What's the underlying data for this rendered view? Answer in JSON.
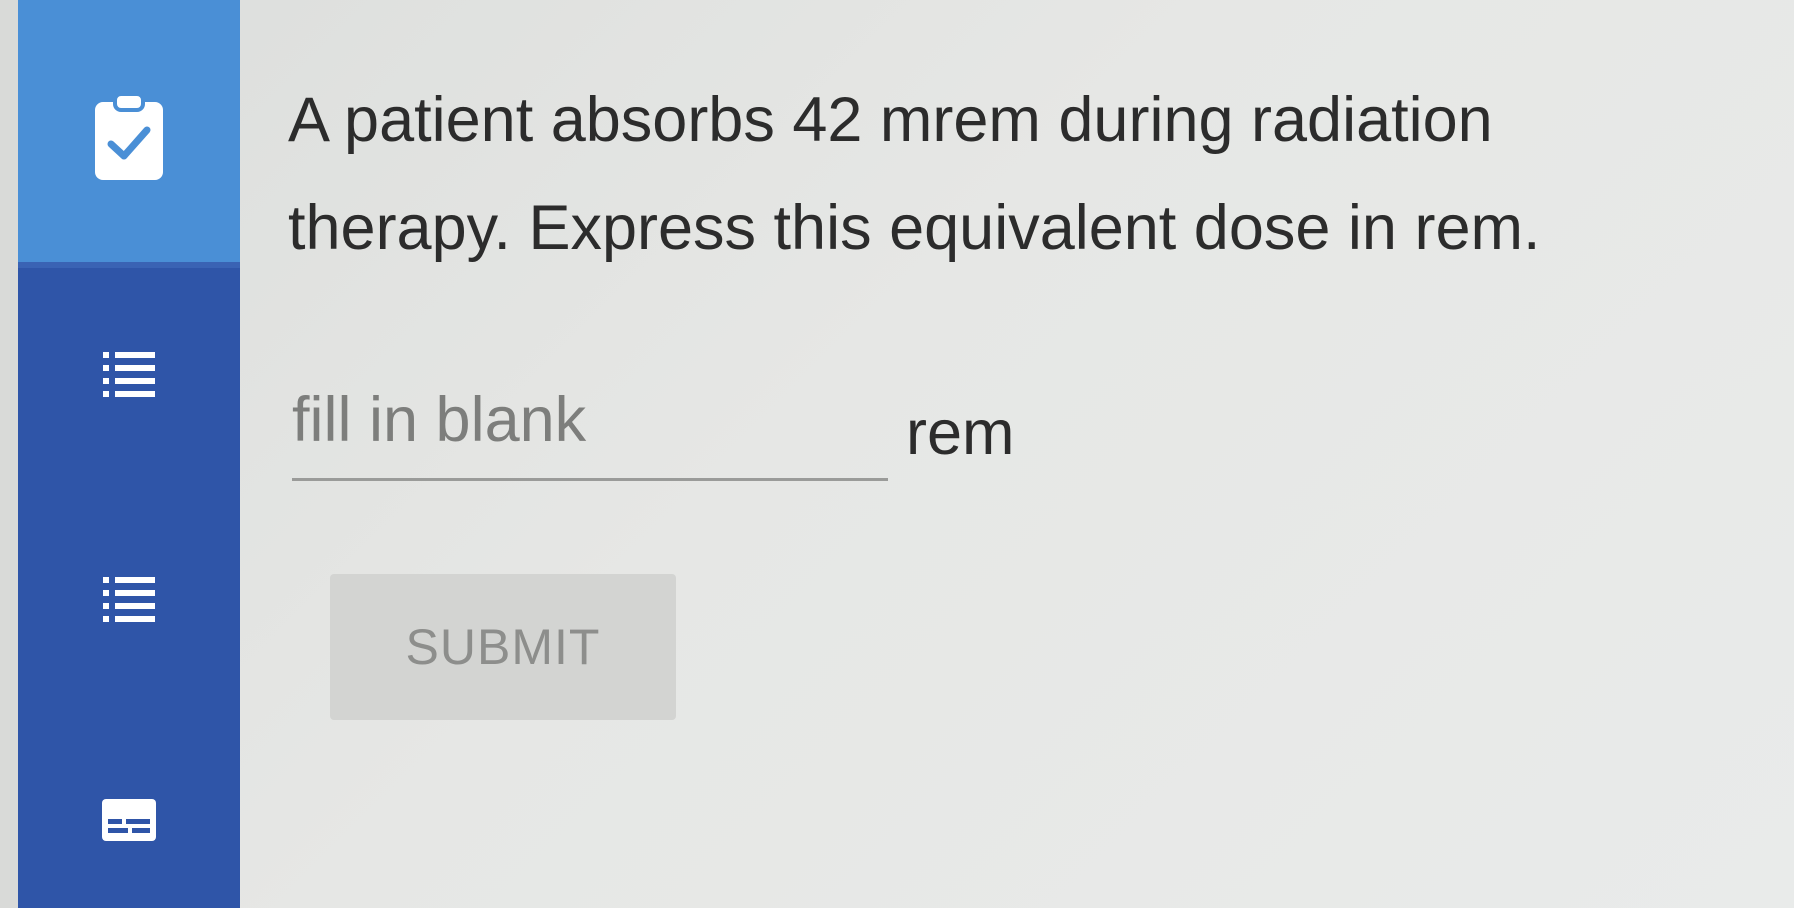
{
  "sidebar": {
    "items": [
      {
        "icon": "clipboard-check-icon",
        "active": true
      },
      {
        "icon": "list-icon",
        "active": false
      },
      {
        "icon": "list-icon",
        "active": false
      },
      {
        "icon": "card-icon",
        "active": false
      }
    ],
    "colors": {
      "active_bg": "#4a8fd6",
      "bg": "#2f55a8",
      "icon": "#ffffff"
    }
  },
  "question": {
    "text": "A patient absorbs 42 mrem during radiation therapy. Express this equivalent dose in rem."
  },
  "answer": {
    "placeholder": "fill in blank",
    "value": "",
    "unit": "rem"
  },
  "submit": {
    "label": "SUBMIT",
    "enabled": false
  }
}
